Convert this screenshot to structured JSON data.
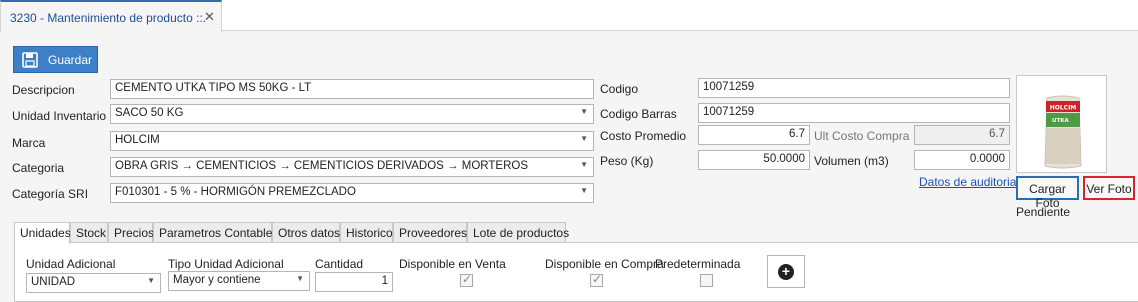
{
  "window": {
    "tab_title": "3230 - Mantenimiento de producto ::.",
    "close_glyph": "✕"
  },
  "toolbar": {
    "save_label": "Guardar"
  },
  "form": {
    "descripcion": {
      "label": "Descripcion",
      "value": "CEMENTO UTKA TIPO MS 50KG - LT"
    },
    "unidad_inventario": {
      "label": "Unidad Inventario",
      "value": "SACO 50 KG"
    },
    "marca": {
      "label": "Marca",
      "value": "HOLCIM"
    },
    "categoria": {
      "label": "Categoria",
      "value": "OBRA GRIS → CEMENTICIOS → CEMENTICIOS DERIVADOS → MORTEROS"
    },
    "categoria_sri": {
      "label": "Categoría SRI",
      "value": "F010301 - 5 % - HORMIGÓN PREMEZCLADO"
    },
    "codigo": {
      "label": "Codigo",
      "value": "10071259"
    },
    "codigo_barras": {
      "label": "Codigo Barras",
      "value": "10071259"
    },
    "costo_promedio": {
      "label": "Costo Promedio",
      "value": "6.7"
    },
    "ult_costo_compra": {
      "label": "Ult Costo Compra",
      "value": "6.7"
    },
    "peso": {
      "label": "Peso (Kg)",
      "value": "50.0000"
    },
    "volumen": {
      "label": "Volumen (m3)",
      "value": "0.0000"
    }
  },
  "photo": {
    "brand_text": "HOLCIM",
    "product_text": "UTKA",
    "cargar_label": "Cargar Foto",
    "ver_label": "Ver Foto",
    "status": "Pendiente"
  },
  "audit_link": "Datos de auditoria",
  "tabs": [
    "Unidades",
    "Stock",
    "Precios",
    "Parametros Contables",
    "Otros datos",
    "Historico",
    "Proveedores",
    "Lote de productos"
  ],
  "unidades": {
    "col_unidad_adicional": "Unidad Adicional",
    "col_tipo": "Tipo Unidad Adicional",
    "col_cantidad": "Cantidad",
    "col_disp_venta": "Disponible en Venta",
    "col_disp_compra": "Disponible en Compra",
    "col_predeterminada": "Predeterminada",
    "unidad_value": "UNIDAD",
    "tipo_value": "Mayor y contiene",
    "cantidad_value": "1",
    "disp_venta_checked": true,
    "disp_compra_checked": true,
    "predeterminada_checked": false
  },
  "colors": {
    "accent": "#2b6fb3",
    "save_bg": "#3f7fc8",
    "ver_border": "#d9232e",
    "link": "#1a50b5"
  }
}
